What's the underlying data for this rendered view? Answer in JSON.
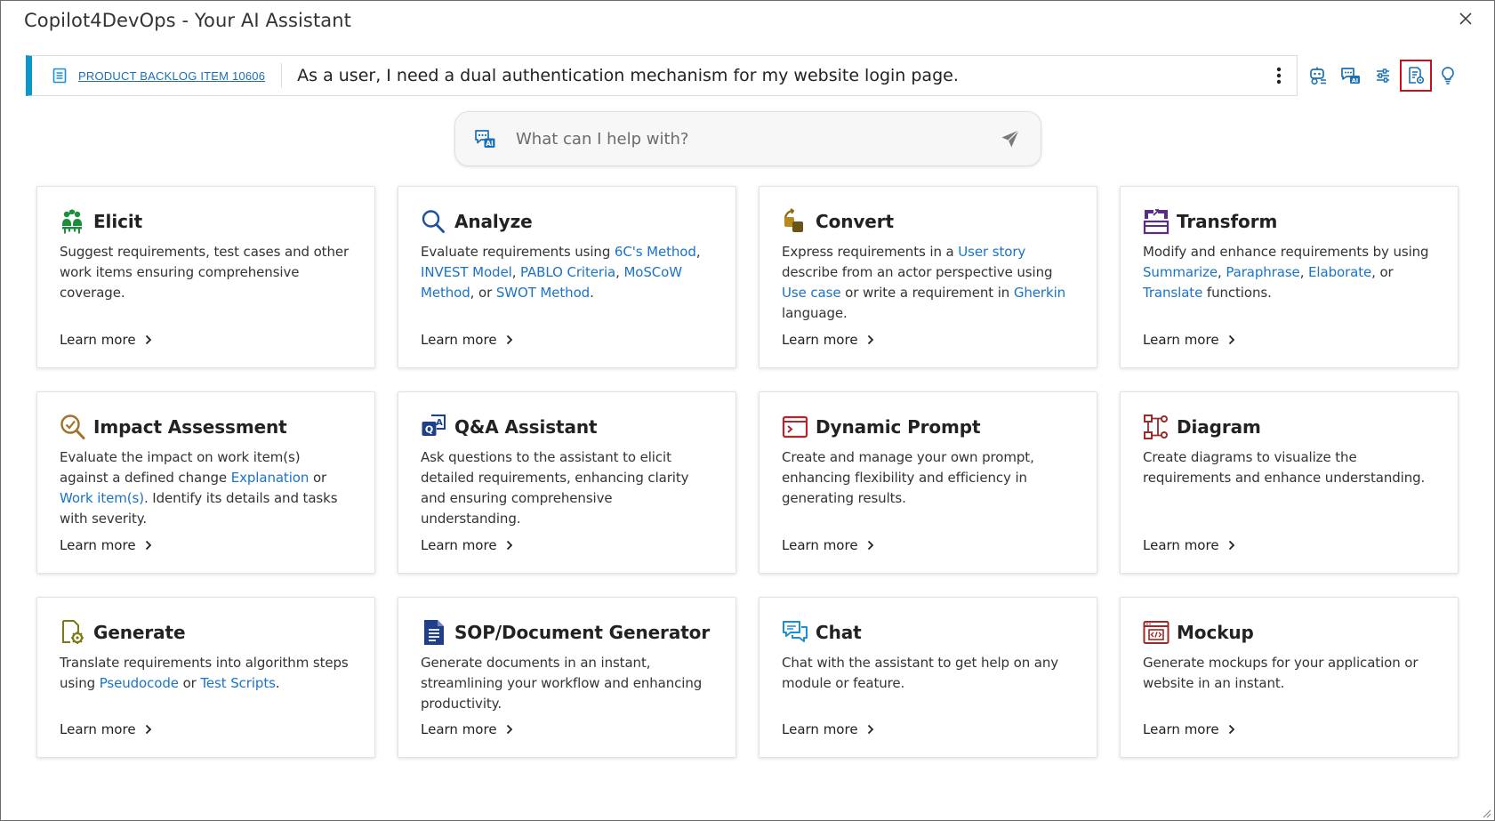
{
  "window": {
    "title": "Copilot4DevOps - Your AI Assistant"
  },
  "work_item": {
    "link": "PRODUCT BACKLOG ITEM 10606",
    "text": "As a user, I need a dual authentication mechanism for my website login page."
  },
  "toolbar": {
    "icons": [
      "bot-settings-icon",
      "chat-ai-icon",
      "sliders-icon",
      "document-settings-icon",
      "lightbulb-icon"
    ],
    "active": "document-settings-icon",
    "accent": "#1a6fb5",
    "active_outline": "#c1121f"
  },
  "prompt": {
    "placeholder": "What can I help with?"
  },
  "cards": [
    {
      "title": "Elicit",
      "icon": "elicit-icon",
      "desc": [
        "Suggest requirements, test cases and other work items ensuring comprehensive coverage."
      ],
      "learn": "Learn more"
    },
    {
      "title": "Analyze",
      "icon": "magnifier-icon",
      "desc": [
        "Evaluate requirements using ",
        "6C's Method",
        ", ",
        "INVEST Model",
        ", ",
        "PABLO Criteria",
        ", ",
        "MoSCoW Method",
        ", or ",
        "SWOT Method",
        "."
      ],
      "learn": "Learn more"
    },
    {
      "title": "Convert",
      "icon": "convert-icon",
      "desc": [
        "Express requirements in a ",
        "User story",
        "  describe from an actor perspective using ",
        "Use case",
        "  or write a requirement in ",
        "Gherkin",
        "  language."
      ],
      "learn": "Learn more"
    },
    {
      "title": "Transform",
      "icon": "transform-icon",
      "desc": [
        "Modify and enhance requirements by using ",
        "Summarize",
        ", ",
        "Paraphrase",
        ", ",
        "Elaborate",
        ", or ",
        "Translate",
        " functions."
      ],
      "learn": "Learn more"
    },
    {
      "title": "Impact Assessment",
      "icon": "impact-icon",
      "desc": [
        "Evaluate the impact on work item(s) against a defined change ",
        "Explanation",
        " or ",
        "Work item(s)",
        ". Identify its details and tasks with severity."
      ],
      "learn": "Learn more"
    },
    {
      "title": "Q&A Assistant",
      "icon": "qa-icon",
      "desc": [
        "Ask questions to the assistant to elicit detailed requirements, enhancing clarity and ensuring comprehensive understanding."
      ],
      "learn": "Learn more"
    },
    {
      "title": "Dynamic Prompt",
      "icon": "terminal-icon",
      "desc": [
        "Create and manage your own prompt, enhancing flexibility and efficiency in generating results."
      ],
      "learn": "Learn more"
    },
    {
      "title": "Diagram",
      "icon": "diagram-icon",
      "desc": [
        "Create diagrams to visualize the requirements and enhance understanding."
      ],
      "learn": "Learn more"
    },
    {
      "title": "Generate",
      "icon": "generate-icon",
      "desc": [
        "Translate requirements into algorithm steps using ",
        "Pseudocode",
        " or ",
        "Test Scripts",
        "."
      ],
      "learn": "Learn more"
    },
    {
      "title": "SOP/Document Generator",
      "icon": "document-icon",
      "desc": [
        "Generate documents in an instant, streamlining your workflow and enhancing productivity."
      ],
      "learn": "Learn more"
    },
    {
      "title": "Chat",
      "icon": "chat-icon",
      "desc": [
        "Chat with the assistant to get help on any module or feature."
      ],
      "learn": "Learn more"
    },
    {
      "title": "Mockup",
      "icon": "mockup-icon",
      "desc": [
        "Generate mockups for your application or website in an instant."
      ],
      "learn": "Learn more"
    }
  ]
}
